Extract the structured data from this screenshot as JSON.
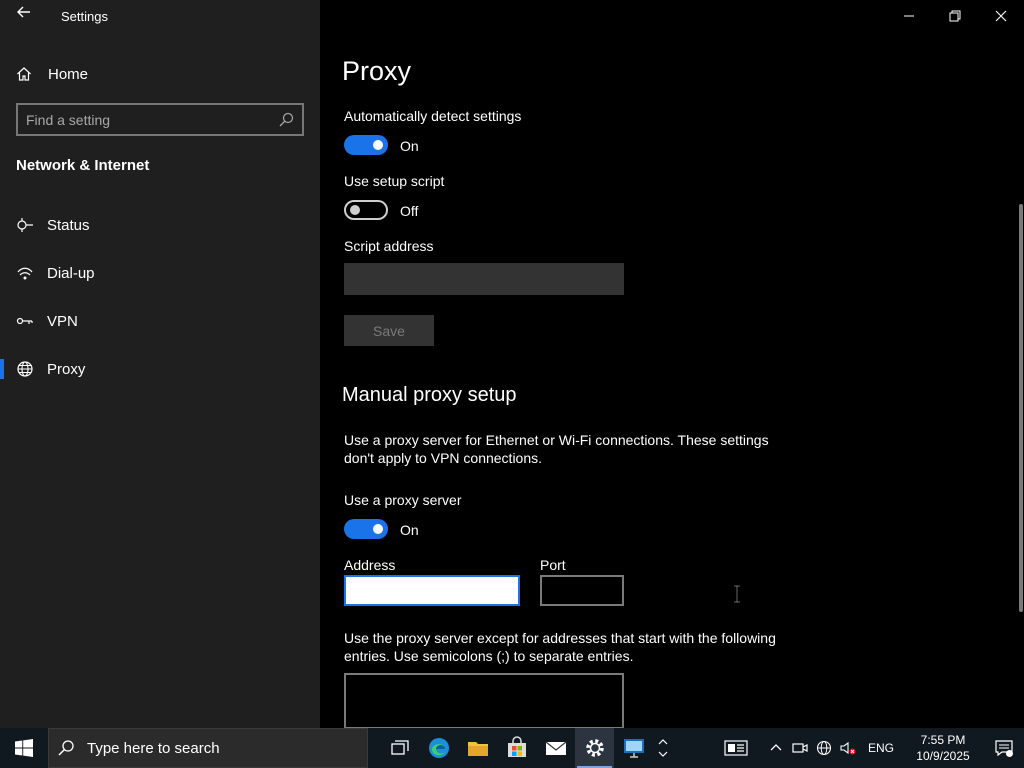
{
  "window": {
    "title": "Settings"
  },
  "sidebar": {
    "home_label": "Home",
    "search_placeholder": "Find a setting",
    "section_title": "Network & Internet",
    "items": [
      {
        "label": "Status",
        "icon": "status-icon"
      },
      {
        "label": "Dial-up",
        "icon": "dialup-icon"
      },
      {
        "label": "VPN",
        "icon": "vpn-icon"
      },
      {
        "label": "Proxy",
        "icon": "globe-icon",
        "selected": true
      }
    ]
  },
  "main": {
    "page_title": "Proxy",
    "auto_detect": {
      "label": "Automatically detect settings",
      "state": "On"
    },
    "setup_script": {
      "label": "Use setup script",
      "state": "Off"
    },
    "script_address": {
      "label": "Script address",
      "value": ""
    },
    "save_label": "Save",
    "manual_heading": "Manual proxy setup",
    "manual_desc_line1": "Use a proxy server for Ethernet or Wi-Fi connections. These settings",
    "manual_desc_line2": "don't apply to VPN connections.",
    "use_proxy": {
      "label": "Use a proxy server",
      "state": "On"
    },
    "address_label": "Address",
    "address_value": "",
    "port_label": "Port",
    "port_value": "",
    "exceptions_desc_line1": "Use the proxy server except for addresses that start with the following",
    "exceptions_desc_line2": "entries. Use semicolons (;) to separate entries.",
    "exceptions_value": ""
  },
  "taskbar": {
    "search_placeholder": "Type here to search",
    "apps": [
      "task-view-icon",
      "edge-icon",
      "file-explorer-icon",
      "store-icon",
      "mail-icon",
      "settings-icon",
      "remote-desktop-icon"
    ],
    "language": "ENG",
    "time": "7:55 PM",
    "date": "10/9/2025"
  },
  "colors": {
    "accent": "#1a73e8",
    "sidebar_bg": "#1f1f1f",
    "content_bg": "#000000",
    "taskbar_bg": "#101820"
  }
}
